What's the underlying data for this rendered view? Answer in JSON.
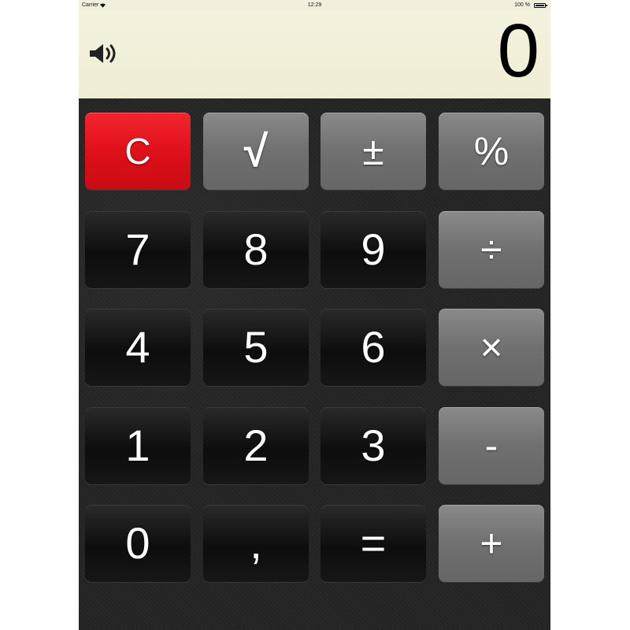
{
  "status_bar": {
    "carrier": "Carrier",
    "time": "12:29",
    "battery": "100 %"
  },
  "display": {
    "value": "0"
  },
  "icons": {
    "sound": "speaker-icon",
    "wifi": "wifi-icon",
    "battery": "battery-icon"
  },
  "colors": {
    "clear_key": "#e0101a",
    "operator_key": "#707070",
    "digit_key": "#111111",
    "display_bg": "#f2f0dc"
  },
  "keys": {
    "clear": "C",
    "sqrt": "√",
    "plusminus": "±",
    "percent": "%",
    "seven": "7",
    "eight": "8",
    "nine": "9",
    "divide": "÷",
    "four": "4",
    "five": "5",
    "six": "6",
    "multiply": "×",
    "one": "1",
    "two": "2",
    "three": "3",
    "minus": "-",
    "zero": "0",
    "comma": ",",
    "equals": "=",
    "plus": "+"
  }
}
